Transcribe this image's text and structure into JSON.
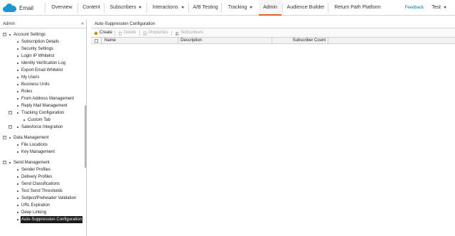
{
  "topnav": {
    "brand": "Email",
    "items": [
      {
        "label": "Overview"
      },
      {
        "label": "Content"
      },
      {
        "label": "Subscribers"
      },
      {
        "label": "Interactions"
      },
      {
        "label": "A/B Testing"
      },
      {
        "label": "Tracking"
      },
      {
        "label": "Admin"
      },
      {
        "label": "Audience Builder"
      },
      {
        "label": "Return Path Platform"
      }
    ],
    "active": "Admin",
    "feedback": "Feedback",
    "user": "Test"
  },
  "sidebar": {
    "title": "Admin",
    "groups": [
      {
        "label": "Account Settings",
        "items": [
          "Subscription Details",
          "Security Settings",
          "Login IP Whitelist",
          "Identity Verification Log",
          "Export Email Whitelist",
          "My Users",
          "Business Units",
          "Roles",
          "From Address Management",
          "Reply Mail Management",
          "Tracking Configuration",
          "Custom Tab",
          "Salesforce Integration"
        ]
      },
      {
        "label": "Data Management",
        "items": [
          "File Locations",
          "Key Management"
        ]
      },
      {
        "label": "Send Management",
        "items": [
          "Sender Profiles",
          "Delivery Profiles",
          "Send Classifications",
          "Test Send Thresholds",
          "Subject/Preheader Validation",
          "URL Expiration",
          "Deep Linking",
          "Auto-Suppression Configuration"
        ]
      }
    ],
    "selected": "Auto-Suppression Configuration"
  },
  "main": {
    "title": "Auto-Suppression Configuration",
    "toolbar": {
      "create": "Create",
      "delete": "Delete",
      "properties": "Properties",
      "subscribers": "Subscribers"
    },
    "columns": {
      "name": "Name",
      "description": "Description",
      "subscriber_count": "Subscriber Count"
    }
  },
  "colors": {
    "accent": "#e35e28",
    "brand": "#1b96d4",
    "link": "#0073b7"
  }
}
